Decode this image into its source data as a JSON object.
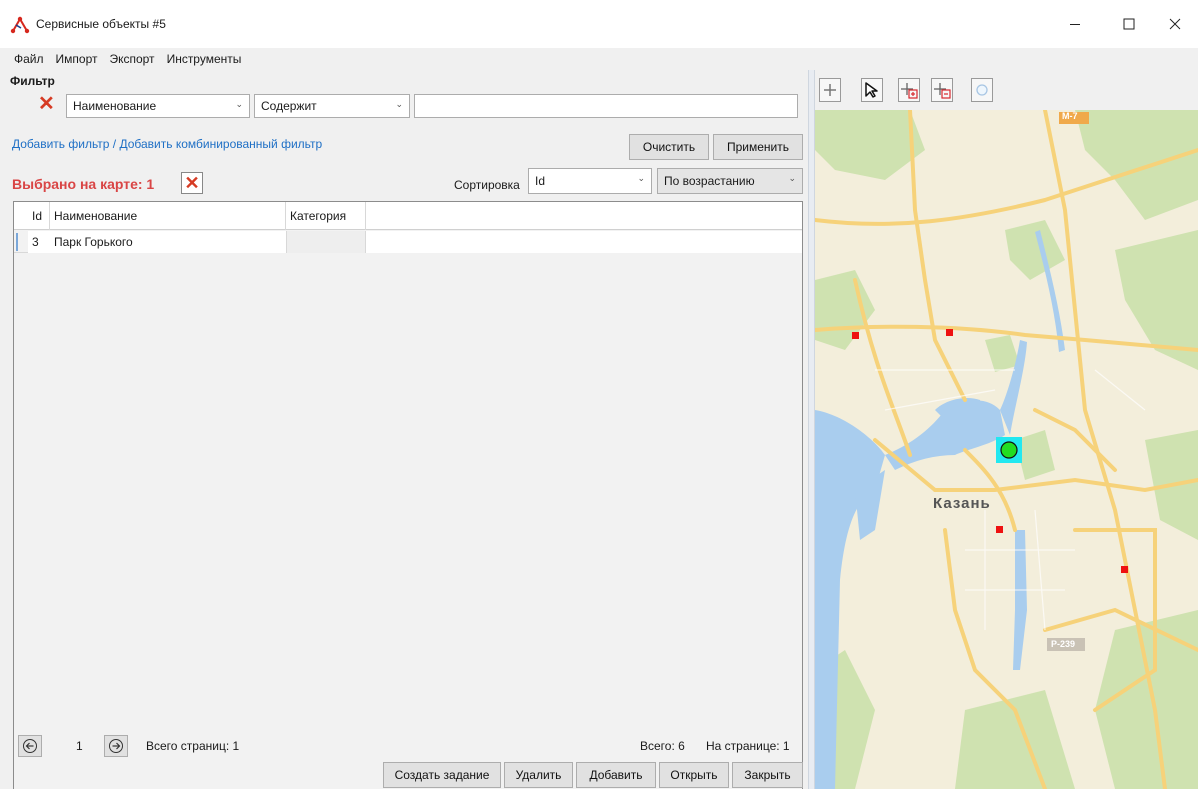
{
  "window": {
    "title": "Сервисные объекты #5"
  },
  "menu": [
    "Файл",
    "Импорт",
    "Экспорт",
    "Инструменты"
  ],
  "filter": {
    "heading": "Фильтр",
    "field_value": "Наименование",
    "operator_value": "Содержит",
    "text_value": "",
    "add_filter_link": "Добавить фильтр",
    "link_separator": " / ",
    "add_combined_link": "Добавить комбинированный фильтр",
    "clear_label": "Очистить",
    "apply_label": "Применить"
  },
  "selection": {
    "label": "Выбрано на карте: 1"
  },
  "sorting": {
    "label": "Сортировка",
    "field_value": "Id",
    "order_value": "По возрастанию"
  },
  "table": {
    "columns": [
      "Id",
      "Наименование",
      "Категория"
    ],
    "rows": [
      {
        "id": "3",
        "name": "Парк Горького",
        "category": ""
      }
    ]
  },
  "paging": {
    "current_page": "1",
    "total_pages_text": "Всего страниц: 1",
    "total_text": "Всего: 6",
    "per_page_text": "На странице: 1"
  },
  "actions": {
    "create_task": "Создать задание",
    "delete": "Удалить",
    "add": "Добавить",
    "open": "Открыть",
    "close": "Закрыть"
  },
  "map": {
    "city_label": "Казань",
    "road_label_1": "M-7",
    "road_label_2": "P-239",
    "colors": {
      "water": "#a9cdee",
      "land": "#f3eedb",
      "greenery": "#cfe2b0",
      "road": "#f6d27a",
      "marker": "#ee1111",
      "selected_marker_fill": "#22dd22",
      "selected_marker_bg": "#22e8f0"
    }
  }
}
